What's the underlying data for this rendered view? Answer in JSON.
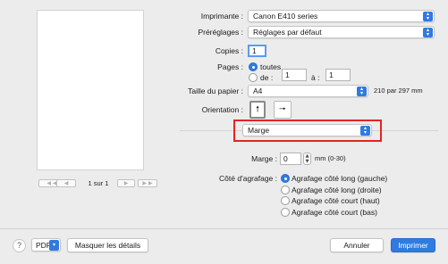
{
  "preview": {
    "prev_first": "◀ ◀",
    "prev": "◀",
    "page_count": "1 sur 1",
    "next": "▶",
    "next_last": "▶ ▶"
  },
  "printer": {
    "label": "Imprimante :",
    "value": "Canon E410 series"
  },
  "presets": {
    "label": "Préréglages :",
    "value": "Réglages par défaut"
  },
  "copies": {
    "label": "Copies :",
    "value": "1"
  },
  "pages": {
    "label": "Pages :",
    "all_label": "toutes",
    "from_label": "de :",
    "from_value": "1",
    "to_label": "à :",
    "to_value": "1"
  },
  "paper_size": {
    "label": "Taille du papier :",
    "value": "A4",
    "dimensions": "210 par 297 mm"
  },
  "orientation": {
    "label": "Orientation :",
    "portrait_icon": "portrait-orientation-icon",
    "landscape_icon": "landscape-orientation-icon"
  },
  "section_menu": {
    "value": "Marge"
  },
  "margin": {
    "label": "Marge :",
    "value": "0",
    "unit": "mm (0-30)"
  },
  "stapling": {
    "label": "Côté d'agrafage :",
    "options": [
      "Agrafage côté long (gauche)",
      "Agrafage côté long (droite)",
      "Agrafage côté court (haut)",
      "Agrafage côté court (bas)"
    ],
    "selected_index": 0
  },
  "footer": {
    "help": "?",
    "pdf": "PDF",
    "details": "Masquer les détails",
    "cancel": "Annuler",
    "print": "Imprimer"
  },
  "colors": {
    "accent": "#2f7be0",
    "highlight": "#e52421"
  }
}
